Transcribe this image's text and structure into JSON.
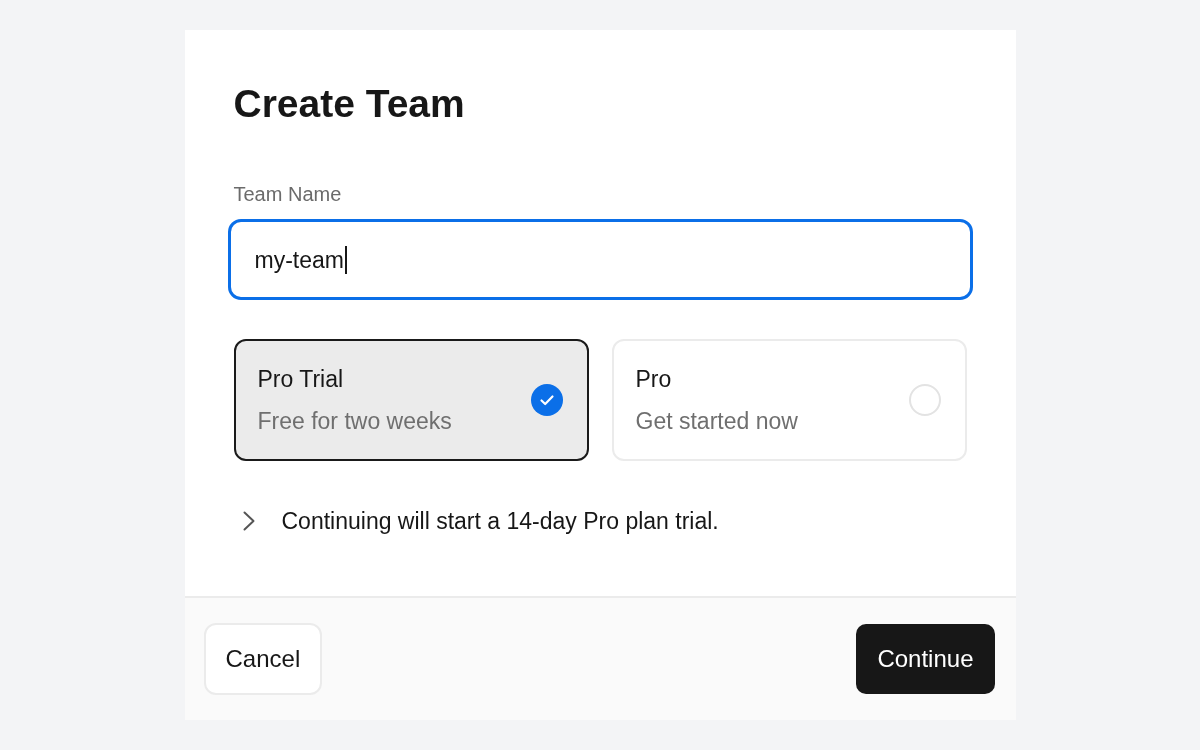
{
  "dialog": {
    "title": "Create Team",
    "field": {
      "label": "Team Name",
      "value": "my-team",
      "focused": true
    },
    "plans": [
      {
        "name": "Pro Trial",
        "description": "Free for two weeks",
        "selected": true
      },
      {
        "name": "Pro",
        "description": "Get started now",
        "selected": false
      }
    ],
    "disclosure": {
      "text": "Continuing will start a 14-day Pro plan trial.",
      "expanded": false
    },
    "buttons": [
      {
        "label": "Cancel",
        "kind": "secondary"
      },
      {
        "label": "Continue",
        "kind": "primary"
      }
    ]
  }
}
